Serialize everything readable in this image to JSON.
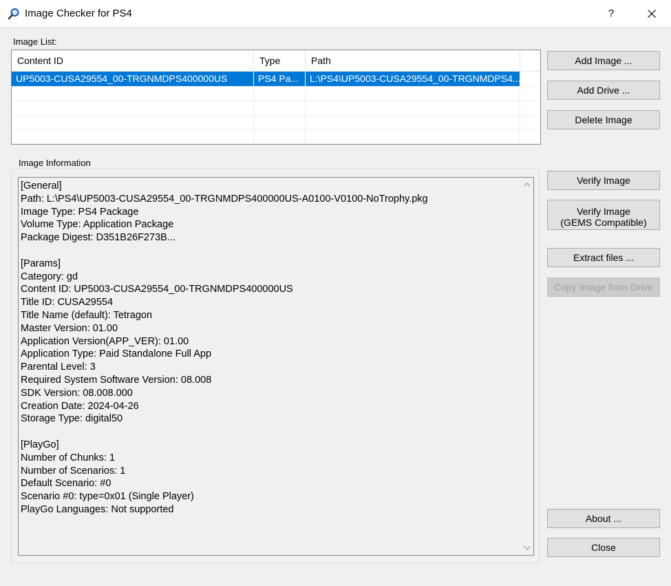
{
  "window": {
    "title": "Image Checker for PS4",
    "help": "?"
  },
  "image_list": {
    "label": "Image List:",
    "columns": [
      "Content ID",
      "Type",
      "Path"
    ],
    "rows": [
      {
        "content_id": "UP5003-CUSA29554_00-TRGNMDPS400000US",
        "type": "PS4 Pa...",
        "path": "L:\\PS4\\UP5003-CUSA29554_00-TRGNMDPS4...",
        "selected": true
      }
    ]
  },
  "image_info": {
    "label": "Image Information",
    "text": "[General]\nPath: L:\\PS4\\UP5003-CUSA29554_00-TRGNMDPS400000US-A0100-V0100-NoTrophy.pkg\nImage Type: PS4 Package\nVolume Type: Application Package\nPackage Digest: D351B26F273B...\n\n[Params]\nCategory: gd\nContent ID: UP5003-CUSA29554_00-TRGNMDPS400000US\nTitle ID: CUSA29554\nTitle Name (default): Tetragon\nMaster Version: 01.00\nApplication Version(APP_VER): 01.00\nApplication Type: Paid Standalone Full App\nParental Level: 3\nRequired System Software Version: 08.008\nSDK Version: 08.008.000\nCreation Date: 2024-04-26\nStorage Type: digital50\n\n[PlayGo]\nNumber of Chunks: 1\nNumber of Scenarios: 1\nDefault Scenario: #0\nScenario #0: type=0x01 (Single Player)\nPlayGo Languages: Not supported"
  },
  "buttons": {
    "add_image": "Add Image ...",
    "add_drive": "Add Drive ...",
    "delete_image": "Delete Image",
    "verify_image": "Verify Image",
    "verify_gems_line1": "Verify Image",
    "verify_gems_line2": "(GEMS Compatible)",
    "extract_files": "Extract files ...",
    "copy_from_drive": "Copy Image from Drive",
    "about": "About ...",
    "close": "Close"
  },
  "colors": {
    "selection": "#0078d7",
    "window_bg": "#f0f0f0"
  },
  "icons": {
    "app": "magnifier-icon",
    "close": "close-icon",
    "scroll_up": "chevron-up-icon",
    "scroll_down": "chevron-down-icon"
  }
}
